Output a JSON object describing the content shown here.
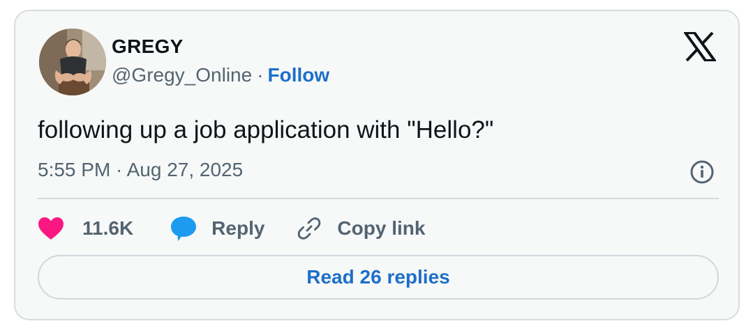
{
  "author": {
    "display_name": "GREGY",
    "handle": "@Gregy_Online",
    "separator": "·",
    "follow_label": "Follow",
    "avatar": "profile-photo-icon"
  },
  "platform_logo": "x-logo-icon",
  "tweet": {
    "text": "following up a job application with \"Hello?\"",
    "timestamp": "5:55 PM · Aug 27, 2025",
    "info_icon": "info-icon"
  },
  "actions": {
    "likes_count": "11.6K",
    "reply_label": "Reply",
    "copy_link_label": "Copy link"
  },
  "read_replies_label": "Read 26 replies",
  "colors": {
    "card_bg": "#f7f8f8",
    "card_border": "#d8dcdf",
    "text_primary": "#0f1419",
    "text_secondary": "#536471",
    "link_blue": "#1d6fc9",
    "like_pink": "#f91880",
    "reply_blue": "#1d9bf0"
  }
}
